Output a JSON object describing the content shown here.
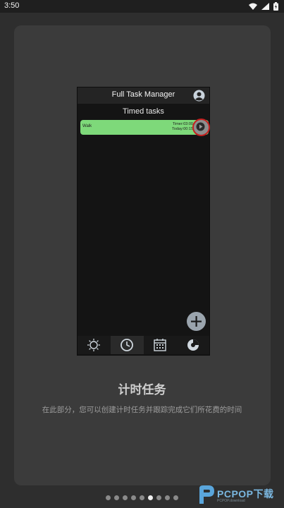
{
  "status_bar": {
    "time": "3:50",
    "icons": [
      "wifi-icon",
      "signal-icon",
      "battery-icon"
    ]
  },
  "preview": {
    "header_title": "Full Task Manager",
    "section_title": "Timed tasks",
    "task": {
      "name": "Walk",
      "timer": "Timer:03:00",
      "today": "Today:00:15"
    },
    "fab_icon": "plus-icon",
    "nav": [
      {
        "icon": "sun-icon",
        "active": false
      },
      {
        "icon": "clock-icon",
        "active": true
      },
      {
        "icon": "calendar-icon",
        "active": false
      },
      {
        "icon": "pie-chart-icon",
        "active": false
      }
    ]
  },
  "feature": {
    "title": "计时任务",
    "description": "在此部分，您可以创建计时任务并跟踪完成它们所花费的时间"
  },
  "pager": {
    "count": 9,
    "active_index": 5
  },
  "watermark": {
    "text": "PCPOP下载",
    "sub": "PCPOP.download"
  },
  "colors": {
    "task_green": "#7ed97a",
    "highlight_red": "#c62020",
    "fab": "#9aa4ad"
  }
}
